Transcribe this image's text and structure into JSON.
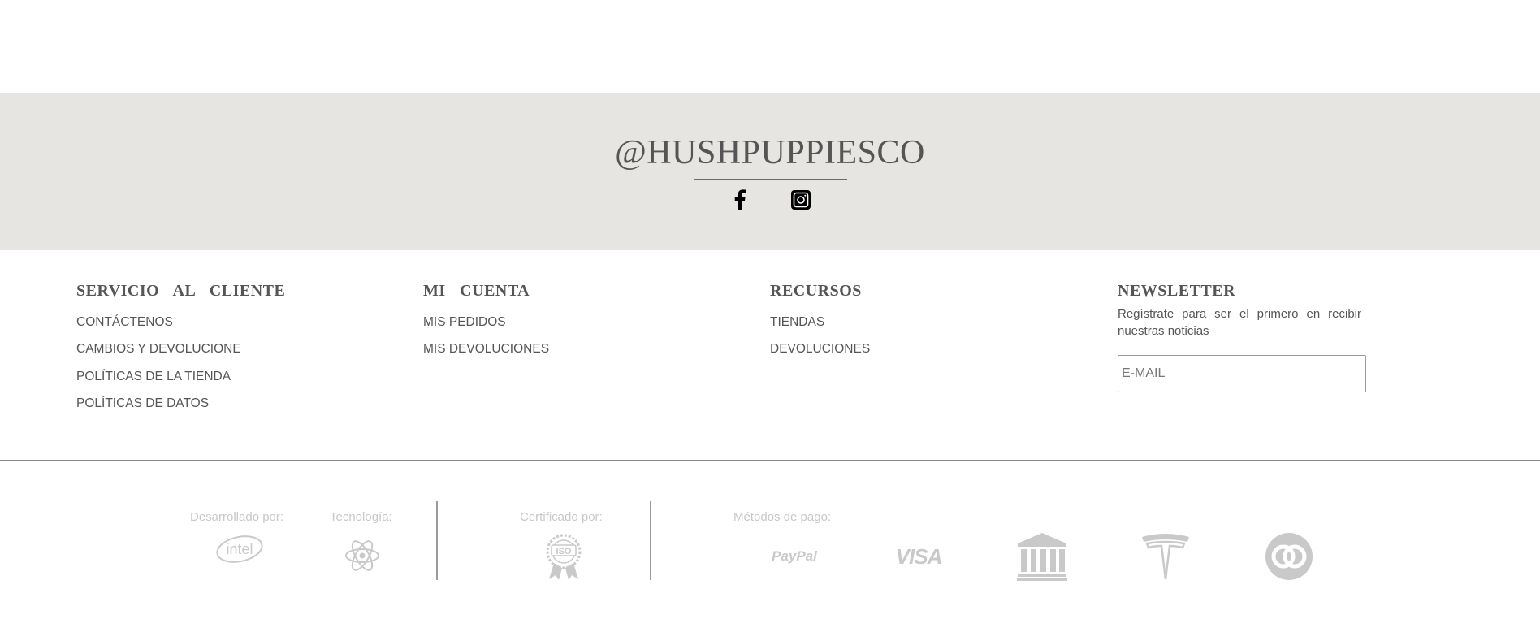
{
  "social": {
    "handle": "@HUSHPUPPIESCO",
    "icons": [
      "facebook-icon",
      "instagram-icon"
    ]
  },
  "columns": {
    "customer_service": {
      "title": "SERVICIO AL CLIENTE",
      "links": [
        "CONTÁCTENOS",
        "CAMBIOS Y DEVOLUCIONE",
        "POLÍTICAS DE LA TIENDA",
        "POLÍTICAS DE DATOS"
      ]
    },
    "my_account": {
      "title": "MI CUENTA",
      "links": [
        "MIS PEDIDOS",
        "MIS DEVOLUCIONES"
      ]
    },
    "resources": {
      "title": "RECURSOS",
      "links": [
        "TIENDAS",
        "DEVOLUCIONES"
      ]
    },
    "newsletter": {
      "title": "NEWSLETTER",
      "text": "Regístrate para ser el primero en recibir nuestras noticias",
      "email_placeholder": "E-MAIL"
    }
  },
  "credits": {
    "developed_by": "Desarrollado por:",
    "technology": "Tecnología:",
    "certified_by": "Certificado por:",
    "payment_methods": "Métodos de pago:",
    "developer_logo": "intel",
    "certificate_logo": "ISO",
    "payment_logos": [
      "PayPal",
      "VISA",
      "bank-icon",
      "tesla-icon",
      "diners-icon"
    ]
  },
  "colors": {
    "band": "#e6e5e2",
    "text": "#555555",
    "muted": "#c8c8c8"
  }
}
